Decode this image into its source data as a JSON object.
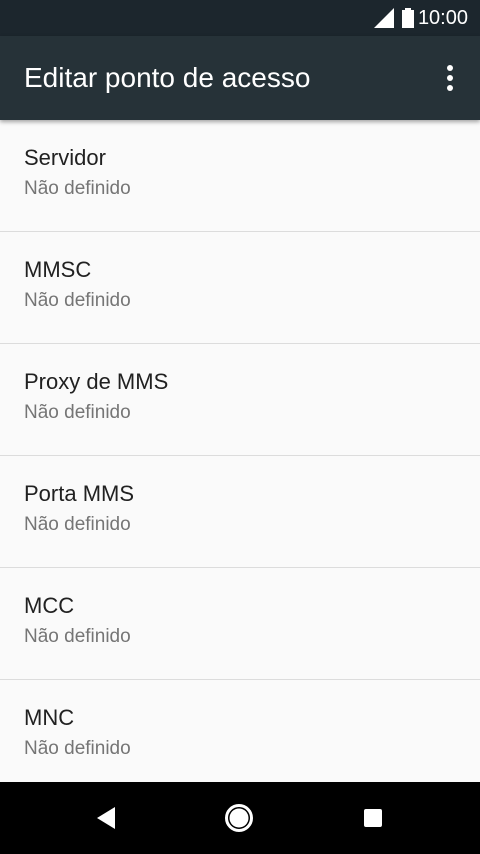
{
  "status_bar": {
    "time": "10:00",
    "icons": [
      "signal-icon",
      "battery-icon"
    ]
  },
  "app_bar": {
    "title": "Editar ponto de acesso",
    "menu_icon": "more-vert-icon"
  },
  "settings": [
    {
      "title": "Servidor",
      "summary": "Não definido"
    },
    {
      "title": "MMSC",
      "summary": "Não definido"
    },
    {
      "title": "Proxy de MMS",
      "summary": "Não definido"
    },
    {
      "title": "Porta MMS",
      "summary": "Não definido"
    },
    {
      "title": "MCC",
      "summary": "Não definido"
    },
    {
      "title": "MNC",
      "summary": "Não definido"
    }
  ],
  "nav_bar": {
    "buttons": [
      "back-icon",
      "home-icon",
      "recents-icon"
    ]
  },
  "colors": {
    "status_bar": "#1c262d",
    "app_bar": "#263238",
    "background": "#fafafa",
    "divider": "#dcdcdc",
    "title_text": "#212121",
    "summary_text": "#757575"
  }
}
